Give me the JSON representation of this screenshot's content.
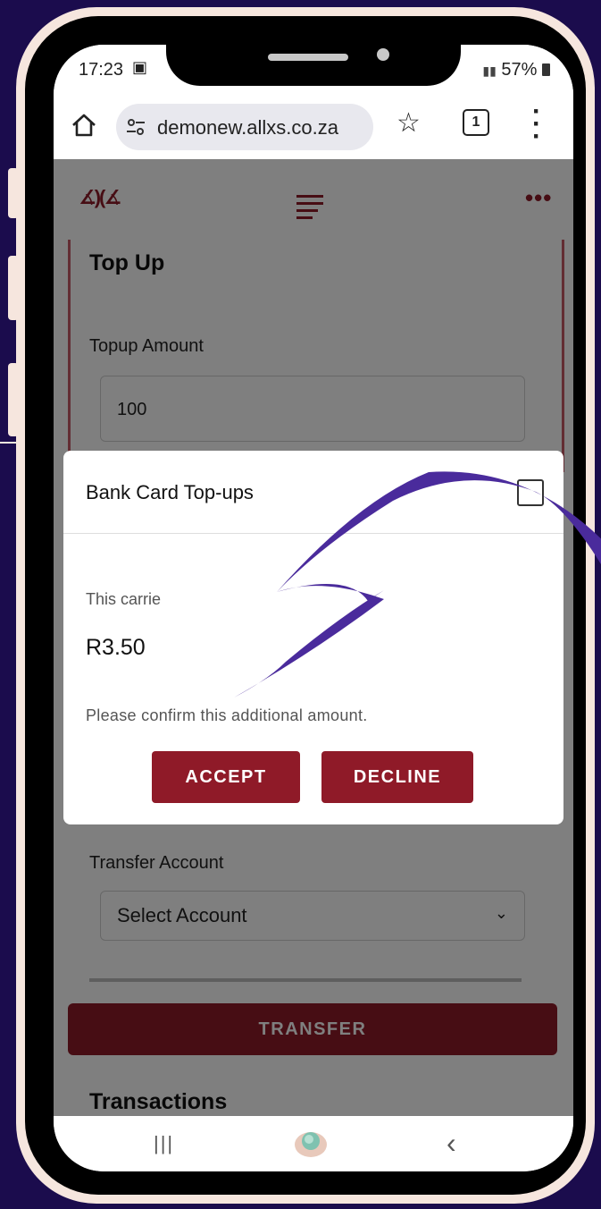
{
  "status_bar": {
    "time": "17:23",
    "battery": "57%"
  },
  "browser": {
    "url": "demonew.allxs.co.za",
    "tab_count": "1"
  },
  "page": {
    "title": "Top Up",
    "topup_amount_label": "Topup Amount",
    "topup_amount_value": "100",
    "transfer_account_label": "Transfer Account",
    "transfer_account_value": "Select Account",
    "transfer_button": "TRANSFER",
    "transactions_title": "Transactions"
  },
  "modal": {
    "title": "Bank Card Top-ups",
    "text_partial": "This carrie",
    "price": "R3.50",
    "confirm_text": "Please confirm this additional amount.",
    "accept_button": "ACCEPT",
    "decline_button": "DECLINE"
  },
  "colors": {
    "background": "#1b0c4d",
    "frame": "#f6e6de",
    "brand": "#8f1a28",
    "arrow": "#4a2b9c"
  },
  "icons": [
    "home-icon",
    "tune-icon",
    "star-icon",
    "tabs-icon",
    "menu-icon",
    "logo-icon",
    "lines-icon",
    "dots-icon",
    "close-icon",
    "chevron-down-icon",
    "recent-apps-icon",
    "home-nav-icon",
    "back-icon",
    "arrow-graphic"
  ]
}
